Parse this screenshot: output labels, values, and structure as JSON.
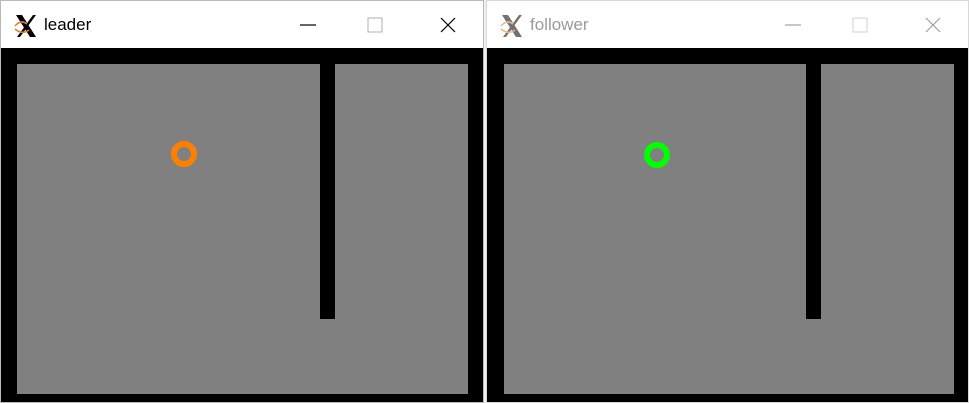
{
  "windows": [
    {
      "title": "leader",
      "agent_color": "#ff7f00",
      "icons": {
        "app": "x-app-icon",
        "minimize": "minimize-icon",
        "maximize": "maximize-icon",
        "close": "close-icon"
      }
    },
    {
      "title": "follower",
      "agent_color": "#00ff00",
      "icons": {
        "app": "x-app-icon",
        "minimize": "minimize-icon",
        "maximize": "maximize-icon",
        "close": "close-icon"
      }
    }
  ],
  "colors": {
    "floor": "#808080",
    "wall": "#000000",
    "titlebar": "#ffffff"
  }
}
